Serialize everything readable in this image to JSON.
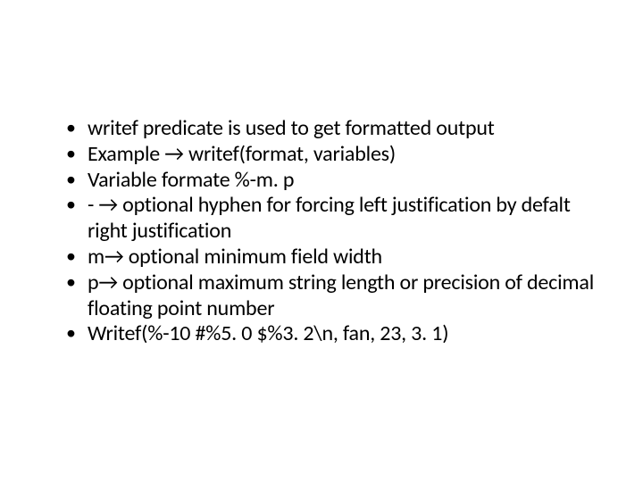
{
  "bullets": [
    "writef predicate is used to get formatted output",
    "Example → writef(format, variables)",
    "Variable formate %-m. p",
    "- → optional hyphen for forcing left justification by defalt right justification",
    "m→ optional minimum field width",
    "p→ optional maximum string length or precision of decimal floating point number",
    "Writef(%-10 #%5. 0 $%3. 2\\n, fan, 23, 3. 1)"
  ]
}
